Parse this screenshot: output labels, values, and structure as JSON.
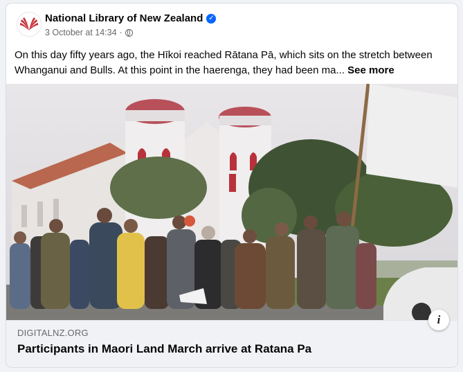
{
  "post": {
    "page_name": "National Library of New Zealand",
    "timestamp": "3 October at 14:34",
    "separator": "·",
    "audience_icon": "globe-icon",
    "verified_icon": "verified-badge-icon",
    "text": "On this day fifty years ago, the Hīkoi reached Rātana Pā, which sits on the stretch between Whanganui and Bulls. At this point in the haerenga, they had been ma...",
    "see_more": "See more"
  },
  "link_preview": {
    "domain": "DIGITALNZ.ORG",
    "title": "Participants in Maori Land March arrive at Ratana Pa",
    "info_icon": "info-icon",
    "info_glyph": "i"
  },
  "colors": {
    "brand_blue": "#0866ff",
    "secondary_text": "#65676b",
    "footer_bg": "#f0f2f5",
    "logo_red": "#c8323c"
  }
}
